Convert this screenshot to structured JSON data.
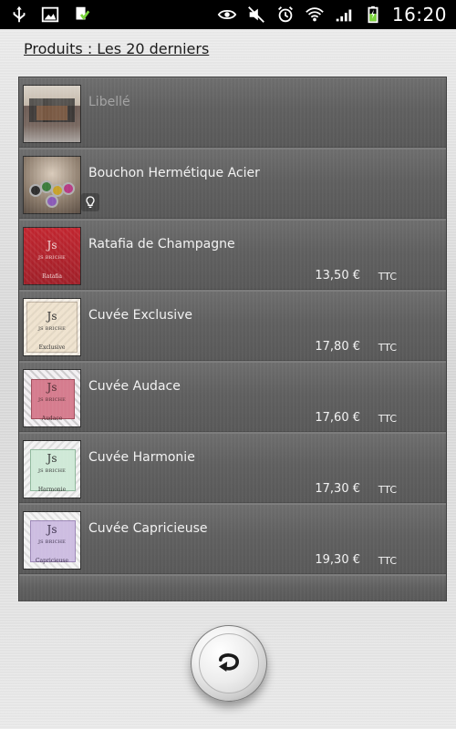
{
  "status_bar": {
    "time": "16:20",
    "left_icons": [
      "usb-icon",
      "image-icon",
      "download-check-icon"
    ],
    "right_icons": [
      "eye-icon",
      "mute-icon",
      "alarm-icon",
      "wifi-icon",
      "signal-icon",
      "battery-charging-icon"
    ]
  },
  "header": {
    "title": "Produits : Les 20 derniers"
  },
  "products": [
    {
      "title": "Libellé",
      "price": "",
      "tax": "",
      "thumb_kind": "photo-room",
      "placeholder": true
    },
    {
      "title": "Bouchon Hermétique Acier",
      "price": "",
      "tax": "",
      "thumb_kind": "photo-caps",
      "badge": "lightbulb-icon"
    },
    {
      "title": "Ratafia de Champagne",
      "price": "13,50 €",
      "tax": "TTC",
      "thumb_kind": "label-red",
      "label_text": "Ratafia"
    },
    {
      "title": "Cuvée Exclusive",
      "price": "17,80 €",
      "tax": "TTC",
      "thumb_kind": "label-cream",
      "label_text": "Exclusive"
    },
    {
      "title": "Cuvée Audace",
      "price": "17,60 €",
      "tax": "TTC",
      "thumb_kind": "label-pink",
      "label_text": "Audace"
    },
    {
      "title": "Cuvée Harmonie",
      "price": "17,30 €",
      "tax": "TTC",
      "thumb_kind": "label-green",
      "label_text": "Harmonie"
    },
    {
      "title": "Cuvée Capricieuse",
      "price": "19,30 €",
      "tax": "TTC",
      "thumb_kind": "label-lilac",
      "label_text": "Capricieuse"
    }
  ],
  "thumb_brand": "JS BRICHE",
  "thumb_monogram": "Js",
  "colors": {
    "row_bg": "#5f5f5f",
    "label_red": "#b2232c",
    "label_cream": "#efe3cf",
    "label_pink": "#d57c8e",
    "label_green": "#cfe9d7",
    "label_lilac": "#cdbde1"
  },
  "back_button": {
    "icon": "back-arrow-icon"
  }
}
